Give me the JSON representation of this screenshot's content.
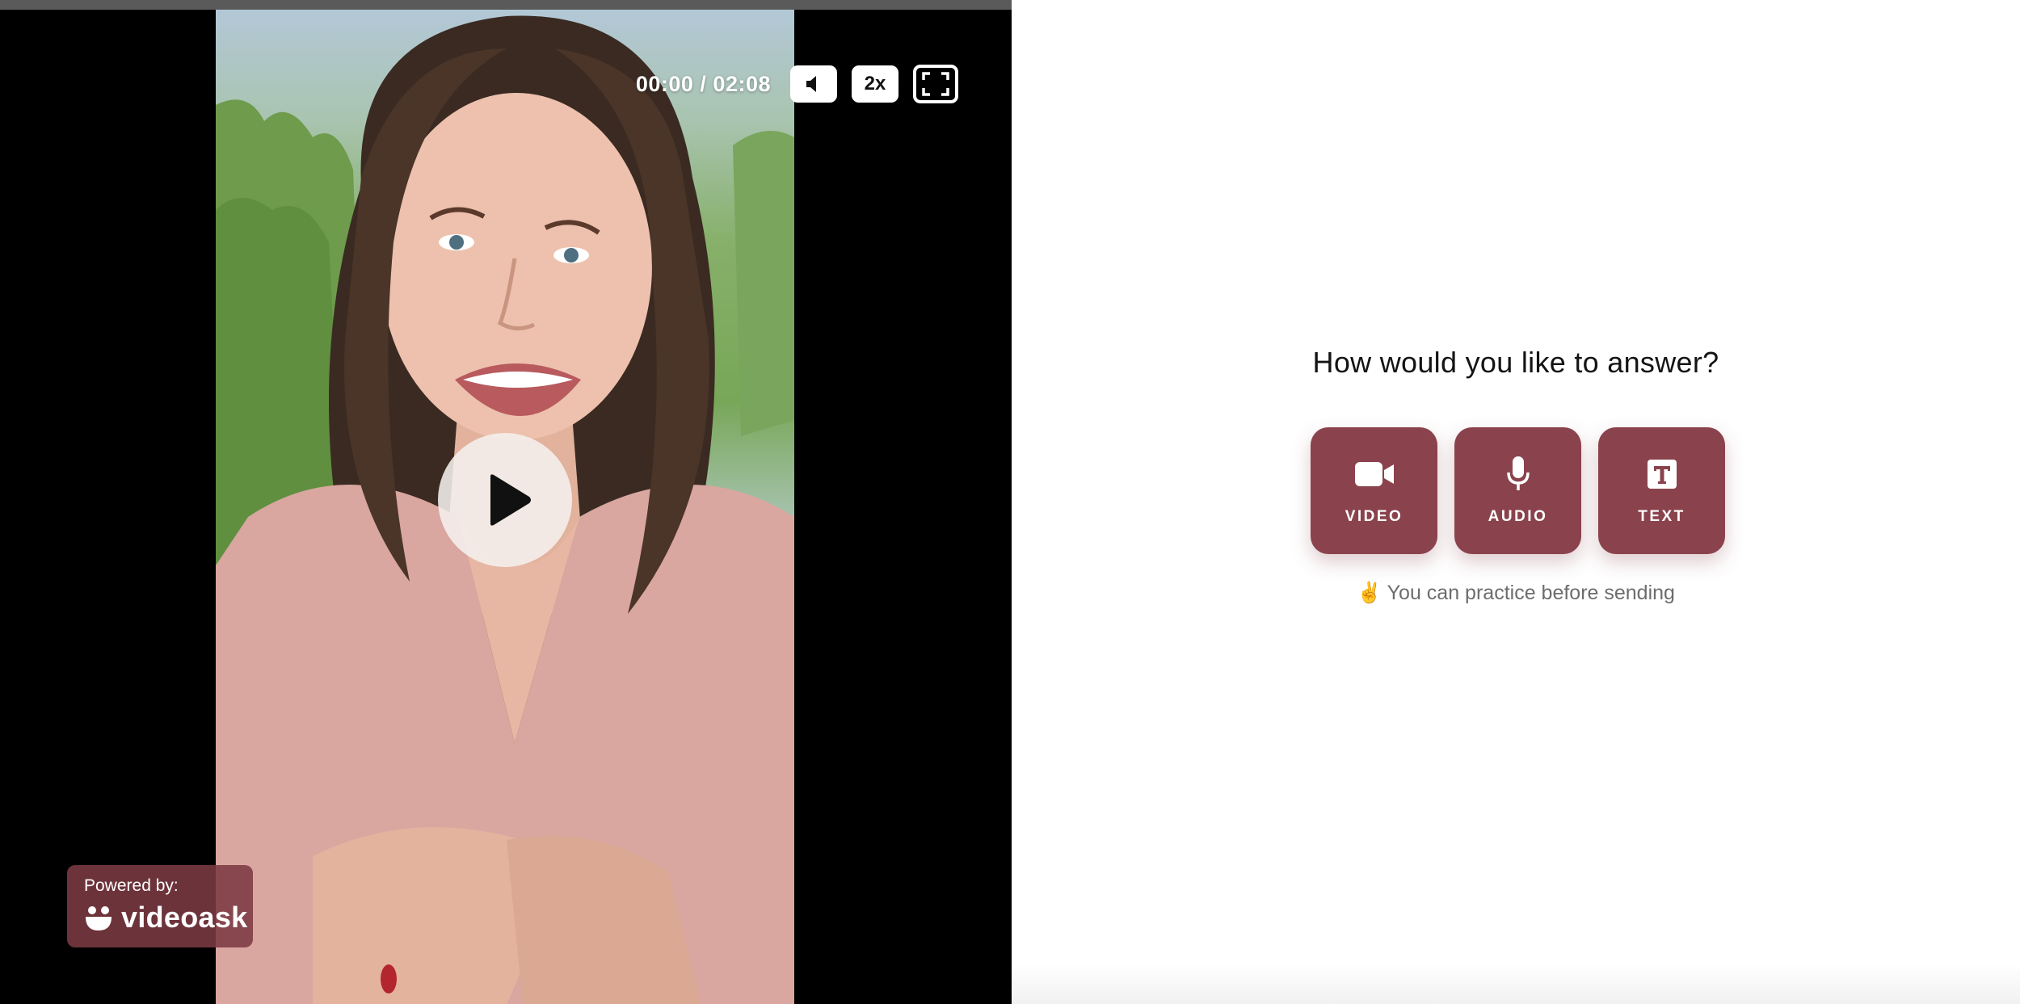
{
  "player": {
    "time": "00:00 / 02:08",
    "progress": 0,
    "mute_icon": "speaker-icon",
    "speed_label": "2x",
    "fullscreen_icon": "fullscreen-icon",
    "play_icon": "play-icon"
  },
  "branding": {
    "powered_label": "Powered by:",
    "brand_name": "videoask",
    "brand_color": "#7c3a42"
  },
  "answer": {
    "question": "How would you like to answer?",
    "options": [
      {
        "label": "VIDEO",
        "icon": "video-camera-icon"
      },
      {
        "label": "AUDIO",
        "icon": "microphone-icon"
      },
      {
        "label": "TEXT",
        "icon": "text-icon"
      }
    ],
    "hint_emoji": "✌️",
    "hint_text": "You can practice before sending",
    "accent_color": "#8a434c"
  }
}
